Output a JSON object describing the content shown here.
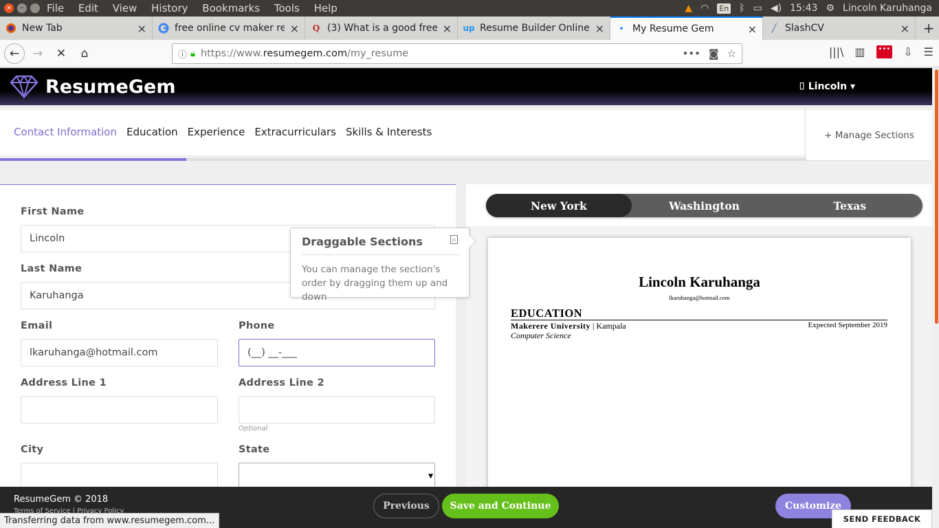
{
  "os": {
    "menu": [
      "File",
      "Edit",
      "View",
      "History",
      "Bookmarks",
      "Tools",
      "Help"
    ],
    "keyboard": "En",
    "clock": "15:43",
    "user": "Lincoln Karuhanga"
  },
  "tabs": [
    {
      "title": "New Tab",
      "icon": "firefox-icon"
    },
    {
      "title": "free online cv maker rev",
      "icon": "google-icon"
    },
    {
      "title": "(3) What is a good free r",
      "icon": "quora-icon"
    },
    {
      "title": "Resume Builder Online:",
      "icon": "upwork-icon"
    },
    {
      "title": "My Resume Gem",
      "icon": "resumegem-icon"
    },
    {
      "title": "SlashCV",
      "icon": "slashcv-icon"
    }
  ],
  "url": {
    "scheme": "https://www.",
    "host": "resumegem.com",
    "path": "/my_resume"
  },
  "site": {
    "brand": "ResumeGem",
    "user": "Lincoln",
    "brand_color": "#8573dc"
  },
  "sections": {
    "items": [
      "Contact Information",
      "Education",
      "Experience",
      "Extracurriculars",
      "Skills & Interests"
    ],
    "manage": "+ Manage Sections",
    "progress": 0.2
  },
  "form": {
    "first_name_label": "First Name",
    "first_name": "Lincoln",
    "last_name_label": "Last Name",
    "last_name": "Karuhanga",
    "email_label": "Email",
    "email": "lkaruhanga@hotmail.com",
    "phone_label": "Phone",
    "phone": "(__) __-___",
    "address1_label": "Address Line 1",
    "address2_label": "Address Line 2",
    "optional": "Optional",
    "city_label": "City",
    "state_label": "State"
  },
  "tooltip": {
    "title": "Draggable Sections",
    "body": "You can manage the section's order by dragging them up and down"
  },
  "templates": [
    "New York",
    "Washington",
    "Texas"
  ],
  "resume": {
    "name": "Lincoln Karuhanga",
    "email": "lkaruhanga@hotmail.com",
    "section": "EDUCATION",
    "school": "Makerere University",
    "location": "| Kampala",
    "date": "Expected September 2019",
    "major": "Computer Science"
  },
  "footer": {
    "copyright": "ResumeGem © 2018",
    "links": "Terms of Service  |  Privacy Policy",
    "previous": "Previous",
    "save": "Save and Continue",
    "customize": "Customize",
    "feedback": "SEND FEEDBACK"
  },
  "status": "Transferring data from www.resumegem.com..."
}
